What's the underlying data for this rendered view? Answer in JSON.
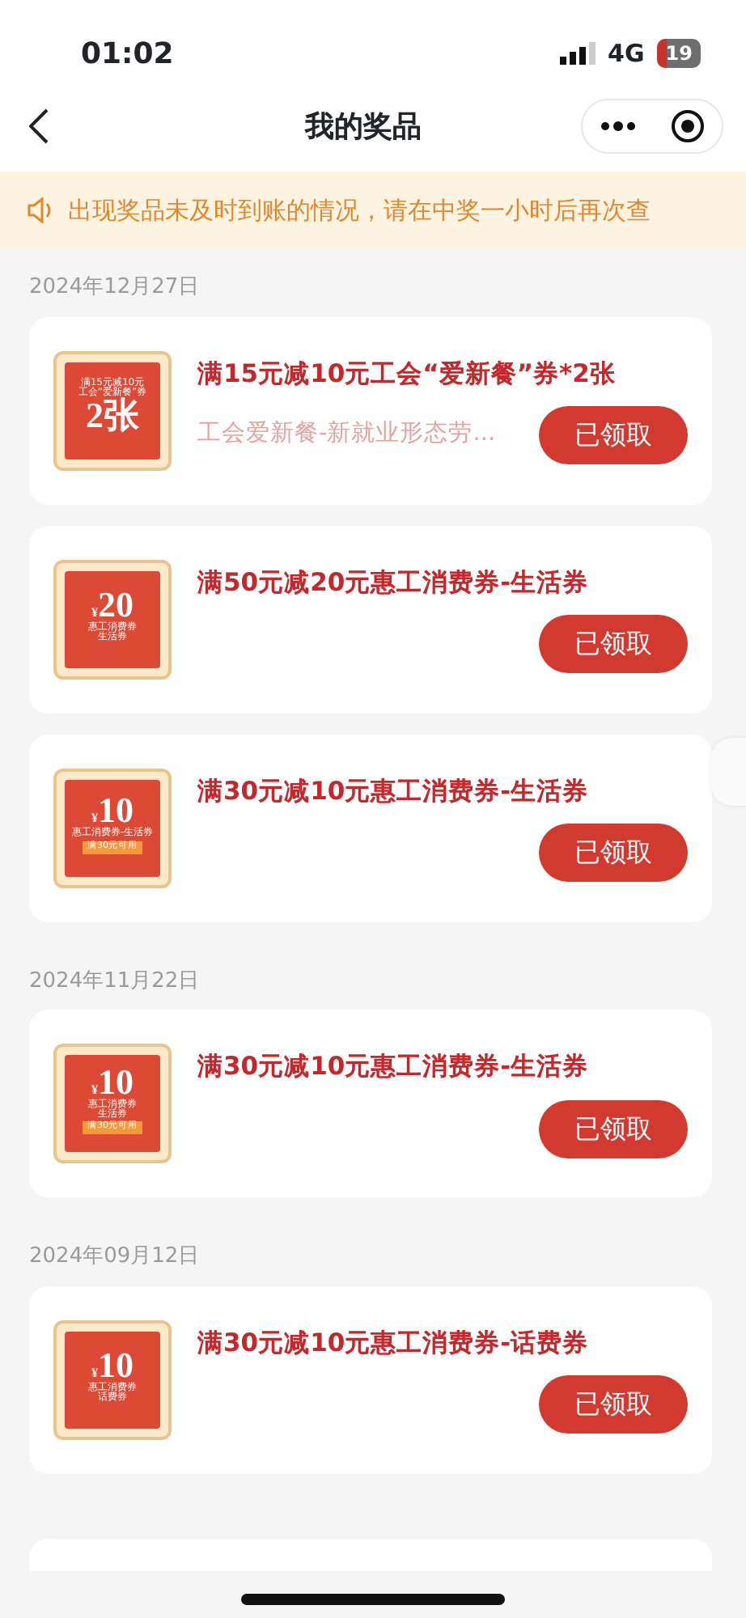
{
  "status_bar": {
    "time": "01:02",
    "network": "4G",
    "battery": "19"
  },
  "nav": {
    "title": "我的奖品"
  },
  "notice": "出现奖品未及时到账的情况，请在中奖一小时后再次查",
  "groups": [
    {
      "date": "2024年12月27日",
      "prizes": [
        {
          "ticket": {
            "top": [
              "满15元减10元",
              "工会“爱新餐”券"
            ],
            "amount": "2张"
          },
          "title": "满15元减10元工会“爱新餐”券*2张",
          "subtitle": "工会爱新餐-新就业形态劳...",
          "button": "已领取"
        },
        {
          "ticket": {
            "currency": "¥",
            "amount": "20",
            "lines": [
              "惠工消费券",
              "生活券"
            ]
          },
          "title": "满50元减20元惠工消费券-生活券",
          "button": "已领取"
        },
        {
          "ticket": {
            "currency": "¥",
            "amount": "10",
            "lines": [
              "惠工消费券-生活券"
            ],
            "tag": "满30元可用"
          },
          "title": "满30元减10元惠工消费券-生活券",
          "button": "已领取"
        }
      ]
    },
    {
      "date": "2024年11月22日",
      "prizes": [
        {
          "ticket": {
            "currency": "¥",
            "amount": "10",
            "lines": [
              "惠工消费券",
              "生活券"
            ],
            "tag": "满30元可用"
          },
          "title": "满30元减10元惠工消费券-生活券",
          "button": "已领取"
        }
      ]
    },
    {
      "date": "2024年09月12日",
      "prizes": [
        {
          "ticket": {
            "currency": "¥",
            "amount": "10",
            "lines": [
              "惠工消费券",
              "话费券"
            ]
          },
          "title": "满30元减10元惠工消费券-话费券",
          "button": "已领取"
        }
      ]
    }
  ]
}
